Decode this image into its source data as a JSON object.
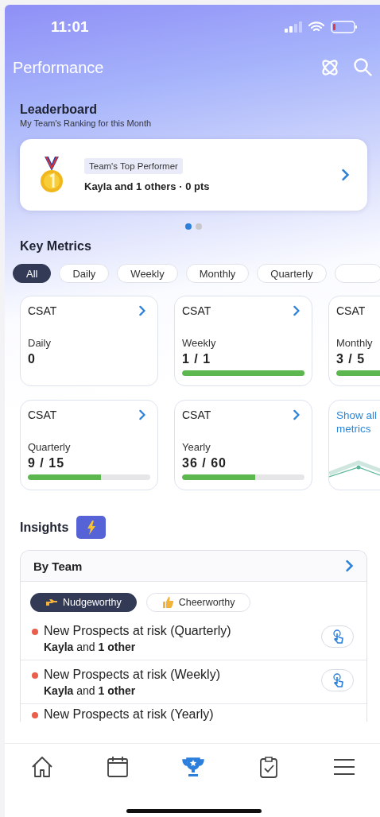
{
  "status_bar": {
    "time": "11:01"
  },
  "header": {
    "title": "Performance"
  },
  "leaderboard": {
    "title": "Leaderboard",
    "subtitle": "My Team's Ranking for this Month",
    "card": {
      "badge": "Team's Top Performer",
      "text": "Kayla and 1 others · 0 pts"
    },
    "pager": [
      {
        "selected": true
      },
      {
        "selected": false
      }
    ]
  },
  "key_metrics": {
    "title": "Key Metrics",
    "filters": [
      {
        "label": "All",
        "selected": true
      },
      {
        "label": "Daily",
        "selected": false
      },
      {
        "label": "Weekly",
        "selected": false
      },
      {
        "label": "Monthly",
        "selected": false
      },
      {
        "label": "Quarterly",
        "selected": false
      }
    ],
    "cards": [
      {
        "kind": "metric",
        "name": "CSAT",
        "period": "Daily",
        "value": "0"
      },
      {
        "kind": "metric",
        "name": "CSAT",
        "period": "Weekly",
        "value": "1 / 1",
        "level": 1
      },
      {
        "kind": "metric",
        "name": "CSAT",
        "period": "Monthly",
        "value": "3 / 5",
        "level": 0.6
      },
      {
        "kind": "metric",
        "name": "CSAT",
        "period": "Quarterly",
        "value": "9 / 15",
        "level": 0.6
      },
      {
        "kind": "metric",
        "name": "CSAT",
        "period": "Yearly",
        "value": "36 / 60",
        "level": 0.6
      },
      {
        "kind": "link",
        "label": "Show all metrics"
      }
    ]
  },
  "insights": {
    "title": "Insights",
    "panel": {
      "title": "By Team",
      "tabs": [
        {
          "label": "Nudgeworthy",
          "kind": "point",
          "selected": true
        },
        {
          "label": "Cheerworthy",
          "kind": "thumb",
          "selected": false
        }
      ],
      "items": [
        {
          "title": "New Prospects at risk (Quarterly)",
          "people": "**Kayla** and **1 other**"
        },
        {
          "title": "New Prospects at risk (Weekly)",
          "people": "**Kayla** and **1 other**"
        },
        {
          "title": "New Prospects at risk (Yearly)"
        }
      ]
    }
  },
  "nav": [
    {
      "kind": "home",
      "selected": false
    },
    {
      "kind": "calendar",
      "selected": false
    },
    {
      "kind": "trophy",
      "selected": true
    },
    {
      "kind": "clipboard",
      "selected": false
    },
    {
      "kind": "menu",
      "selected": false
    }
  ]
}
